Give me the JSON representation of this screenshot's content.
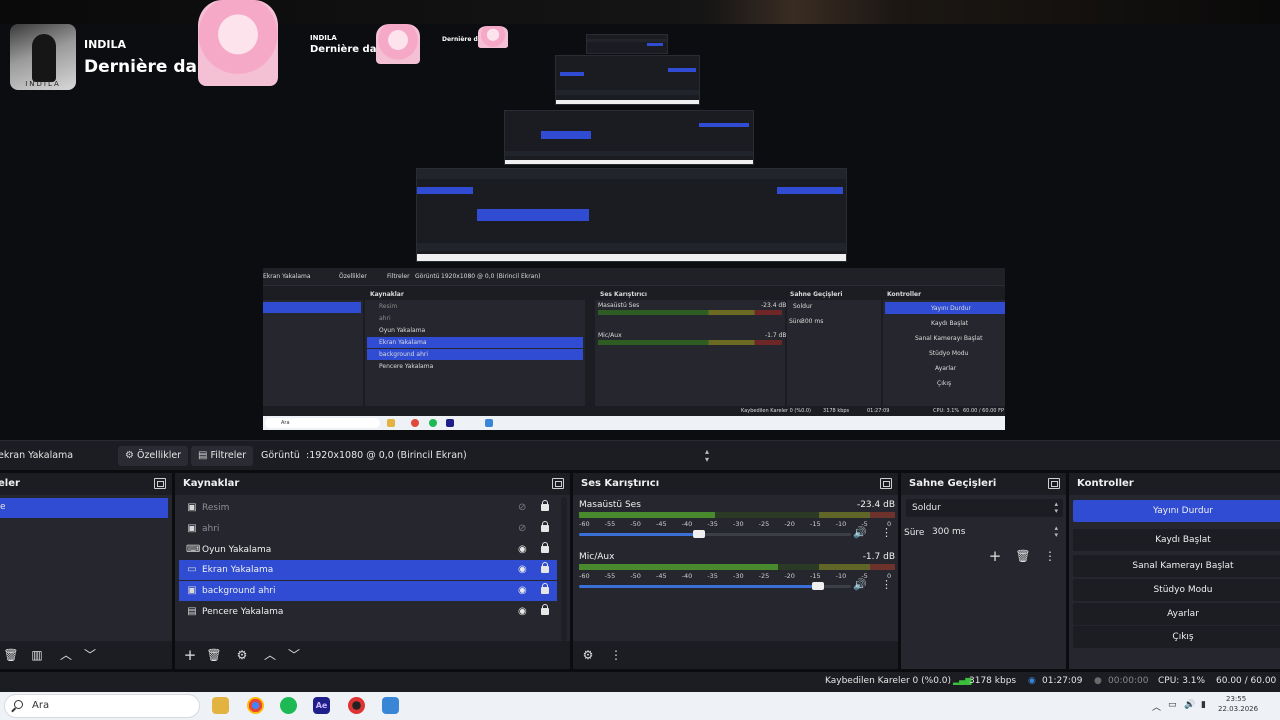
{
  "preview": {
    "music": {
      "artist": "INDILA",
      "song": "Dernière da",
      "album_caption": "INDILA"
    },
    "echo1": {
      "artist": "INDILA",
      "song": "Dernière da"
    },
    "echo2": {
      "song": "Dernière d"
    },
    "mini": {
      "toolbar_left": "Ekran Yakalama",
      "props": "Özellikler",
      "filters": "Filtreler",
      "display_label": "Görüntü",
      "display_value": "1920x1080 @ 0,0 (Birincil Ekran)",
      "sources_title": "Kaynaklar",
      "sources": [
        "Resim",
        "ahri",
        "Oyun Yakalama",
        "Ekran Yakalama",
        "background ahri",
        "Pencere Yakalama"
      ],
      "mixer_title": "Ses Karıştırıcı",
      "ch1": "Masaüstü Ses",
      "ch1_db": "-23.4 dB",
      "ch2": "Mic/Aux",
      "ch2_db": "-1.7 dB",
      "transitions_title": "Sahne Geçişleri",
      "transition": "Soldur",
      "duration_label": "Süre",
      "duration": "300 ms",
      "controls_title": "Kontroller",
      "controls": [
        "Yayını Durdur",
        "Kaydı Başlat",
        "Sanal Kamerayı Başlat",
        "Stüdyo Modu",
        "Ayarlar",
        "Çıkış"
      ],
      "status_dropped": "Kaybedilen Kareler 0 (%0.0)",
      "status_kbps": "3178 kbps",
      "status_time": "01:27:09",
      "status_cpu": "CPU: 3.1%",
      "status_fps": "60.00 / 60.00 FP",
      "task_search": "Ara"
    }
  },
  "toolbar": {
    "source_name": "ekran Yakalama",
    "properties": "Özellikler",
    "filters": "Filtreler",
    "display_label": "Görüntü",
    "display_value": ":1920x1080 @ 0,0 (Birincil Ekran)"
  },
  "scenes": {
    "title": "eler",
    "selected": "e"
  },
  "sources": {
    "title": "Kaynaklar",
    "items": [
      {
        "name": "Resim",
        "icon": "image-icon"
      },
      {
        "name": "ahri",
        "icon": "image-icon"
      },
      {
        "name": "Oyun Yakalama",
        "icon": "gamepad-icon"
      },
      {
        "name": "Ekran Yakalama",
        "icon": "monitor-icon"
      },
      {
        "name": "background ahri",
        "icon": "image-icon"
      },
      {
        "name": "Pencere Yakalama",
        "icon": "window-icon"
      }
    ]
  },
  "mixer": {
    "title": "Ses Karıştırıcı",
    "ticks": [
      "-60",
      "-55",
      "-50",
      "-45",
      "-40",
      "-35",
      "-30",
      "-25",
      "-20",
      "-15",
      "-10",
      "-5",
      "0"
    ],
    "channels": [
      {
        "name": "Masaüstü Ses",
        "db": "-23.4 dB",
        "level": 0.43,
        "fader": 0.44
      },
      {
        "name": "Mic/Aux",
        "db": "-1.7 dB",
        "level": 0.63,
        "fader": 0.88
      }
    ]
  },
  "transitions": {
    "title": "Sahne Geçişleri",
    "selected": "Soldur",
    "duration_label": "Süre",
    "duration": "300 ms"
  },
  "controls": {
    "title": "Kontroller",
    "buttons": [
      "Yayını Durdur",
      "Kaydı Başlat",
      "Sanal Kamerayı Başlat",
      "Stüdyo Modu",
      "Ayarlar",
      "Çıkış"
    ]
  },
  "status": {
    "dropped": "Kaybedilen Kareler 0 (%0.0)",
    "kbps": "3178 kbps",
    "stream_time": "01:27:09",
    "rec_time": "00:00:00",
    "cpu": "CPU: 3.1%",
    "fps": "60.00 / 60.00 FP"
  },
  "taskbar": {
    "search_placeholder": "Ara",
    "time": "23:55",
    "date": "22.03.2026"
  },
  "colors": {
    "accent": "#2f4cd3",
    "dock_bg": "#26272e",
    "header_bg": "#1c1d23",
    "meter_green": "#4a8a2f",
    "meter_yellow": "#8a8a2a",
    "meter_red": "#8a2f2f"
  }
}
